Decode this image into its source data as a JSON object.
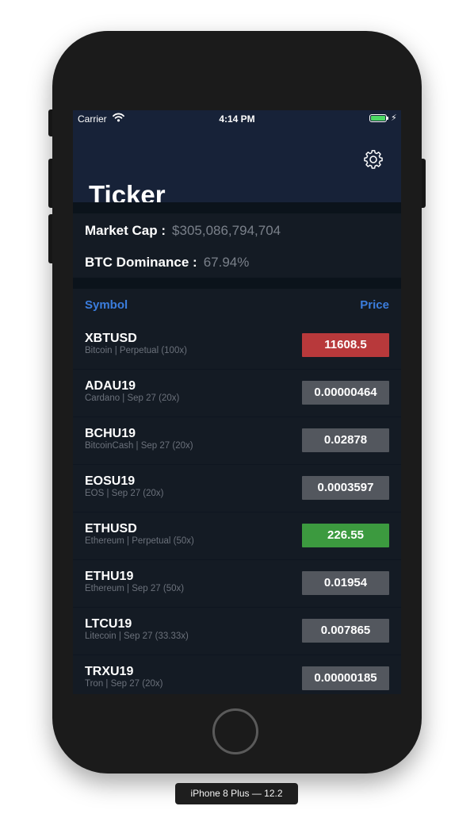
{
  "status_bar": {
    "carrier": "Carrier",
    "time": "4:14 PM"
  },
  "nav": {
    "title": "Ticker",
    "settings_icon": "gear-icon"
  },
  "stats": {
    "market_cap_label": "Market Cap :",
    "market_cap_value": "$305,086,794,704",
    "btc_dominance_label": "BTC Dominance :",
    "btc_dominance_value": "67.94%"
  },
  "table": {
    "symbol_header": "Symbol",
    "price_header": "Price",
    "rows": [
      {
        "symbol": "XBTUSD",
        "subtitle": "Bitcoin | Perpetual (100x)",
        "price": "11608.5",
        "color": "#b8393b"
      },
      {
        "symbol": "ADAU19",
        "subtitle": "Cardano | Sep 27 (20x)",
        "price": "0.00000464",
        "color": "#53575e"
      },
      {
        "symbol": "BCHU19",
        "subtitle": "BitcoinCash | Sep 27 (20x)",
        "price": "0.02878",
        "color": "#53575e"
      },
      {
        "symbol": "EOSU19",
        "subtitle": "EOS | Sep 27 (20x)",
        "price": "0.0003597",
        "color": "#53575e"
      },
      {
        "symbol": "ETHUSD",
        "subtitle": "Ethereum | Perpetual (50x)",
        "price": "226.55",
        "color": "#3c9a3f"
      },
      {
        "symbol": "ETHU19",
        "subtitle": "Ethereum | Sep 27 (50x)",
        "price": "0.01954",
        "color": "#53575e"
      },
      {
        "symbol": "LTCU19",
        "subtitle": "Litecoin | Sep 27 (33.33x)",
        "price": "0.007865",
        "color": "#53575e"
      },
      {
        "symbol": "TRXU19",
        "subtitle": "Tron | Sep 27 (20x)",
        "price": "0.00000185",
        "color": "#53575e"
      }
    ]
  },
  "device": {
    "caption": "iPhone 8 Plus — 12.2"
  }
}
